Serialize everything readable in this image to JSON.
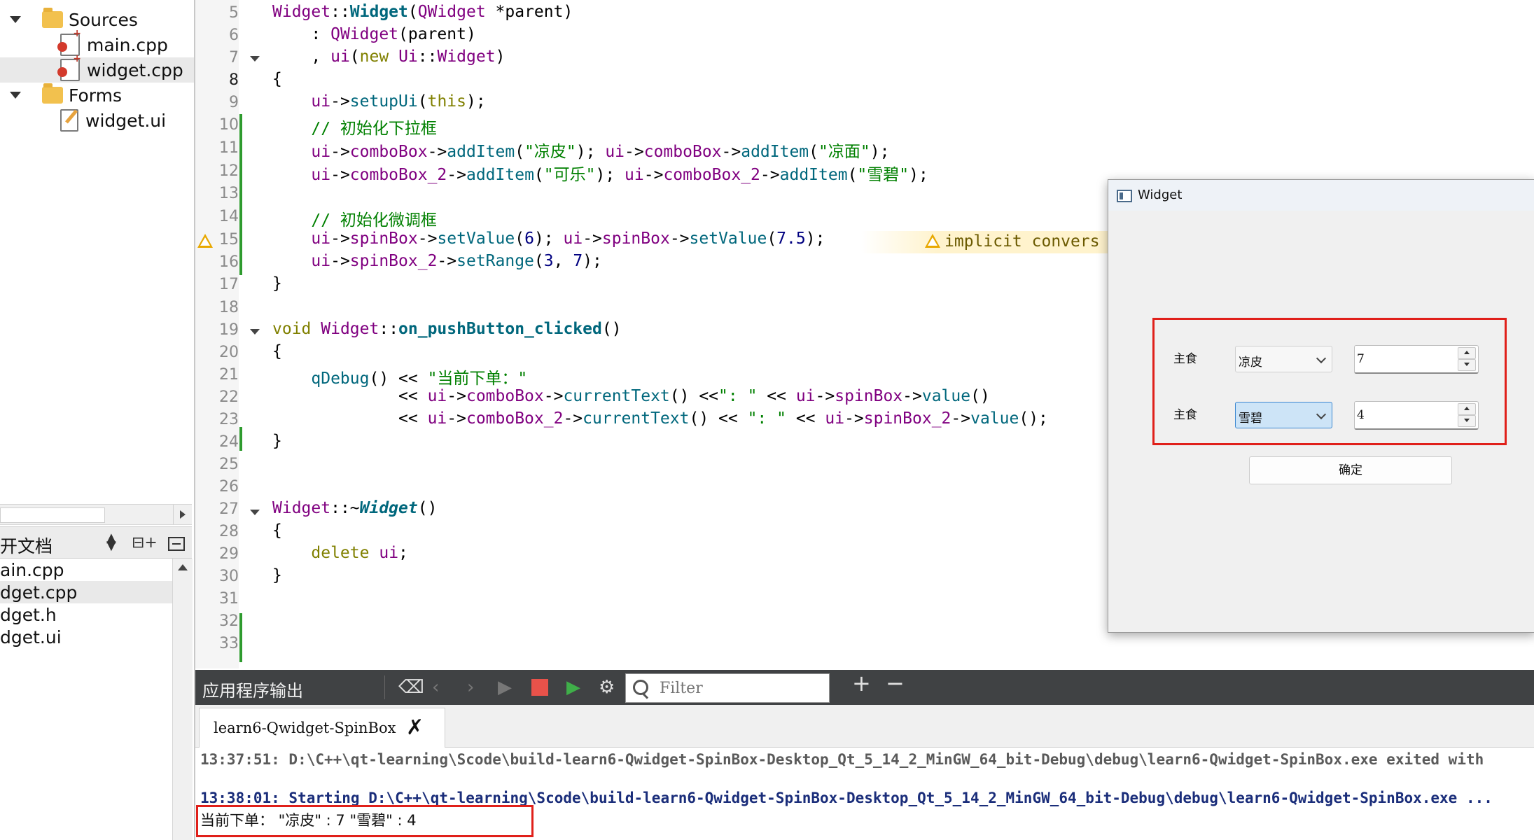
{
  "project_tree": {
    "sources_label": "Sources",
    "files": [
      "main.cpp",
      "widget.cpp"
    ],
    "forms_label": "Forms",
    "form_files": [
      "widget.ui"
    ]
  },
  "open_docs": {
    "header": "开文档",
    "items": [
      "ain.cpp",
      "dget.cpp",
      "dget.h",
      "dget.ui"
    ]
  },
  "editor": {
    "line_numbers": [
      "5",
      "6",
      "7",
      "8",
      "9",
      "10",
      "11",
      "12",
      "13",
      "14",
      "15",
      "16",
      "17",
      "18",
      "19",
      "20",
      "21",
      "22",
      "23",
      "24",
      "25",
      "26",
      "27",
      "28",
      "29",
      "30",
      "31",
      "32",
      "33"
    ],
    "current_line": "8",
    "warning": "implicit convers"
  },
  "output": {
    "panel_title": "应用程序输出",
    "filter_placeholder": "Filter",
    "tab_label": "learn6-Qwidget-SpinBox",
    "lines": [
      "13:37:51: D:\\C++\\qt-learning\\Scode\\build-learn6-Qwidget-SpinBox-Desktop_Qt_5_14_2_MinGW_64_bit-Debug\\debug\\learn6-Qwidget-SpinBox.exe exited with",
      "13:38:01: Starting D:\\C++\\qt-learning\\Scode\\build-learn6-Qwidget-SpinBox-Desktop_Qt_5_14_2_MinGW_64_bit-Debug\\debug\\learn6-Qwidget-SpinBox.exe ...",
      "当前下单：  \"凉皮\" :  7 \"雪碧\" :  4"
    ]
  },
  "widget_window": {
    "title": "Widget",
    "row1": {
      "label": "主食",
      "combo": "凉皮",
      "spin": "7"
    },
    "row2": {
      "label": "主食",
      "combo": "雪碧",
      "spin": "4"
    },
    "ok_button": "确定"
  },
  "colors": {
    "highlight_red": "#e0201a",
    "output_toolbar": "#404244",
    "change_marker": "#2e9b2e",
    "warning": "#e8a800"
  }
}
